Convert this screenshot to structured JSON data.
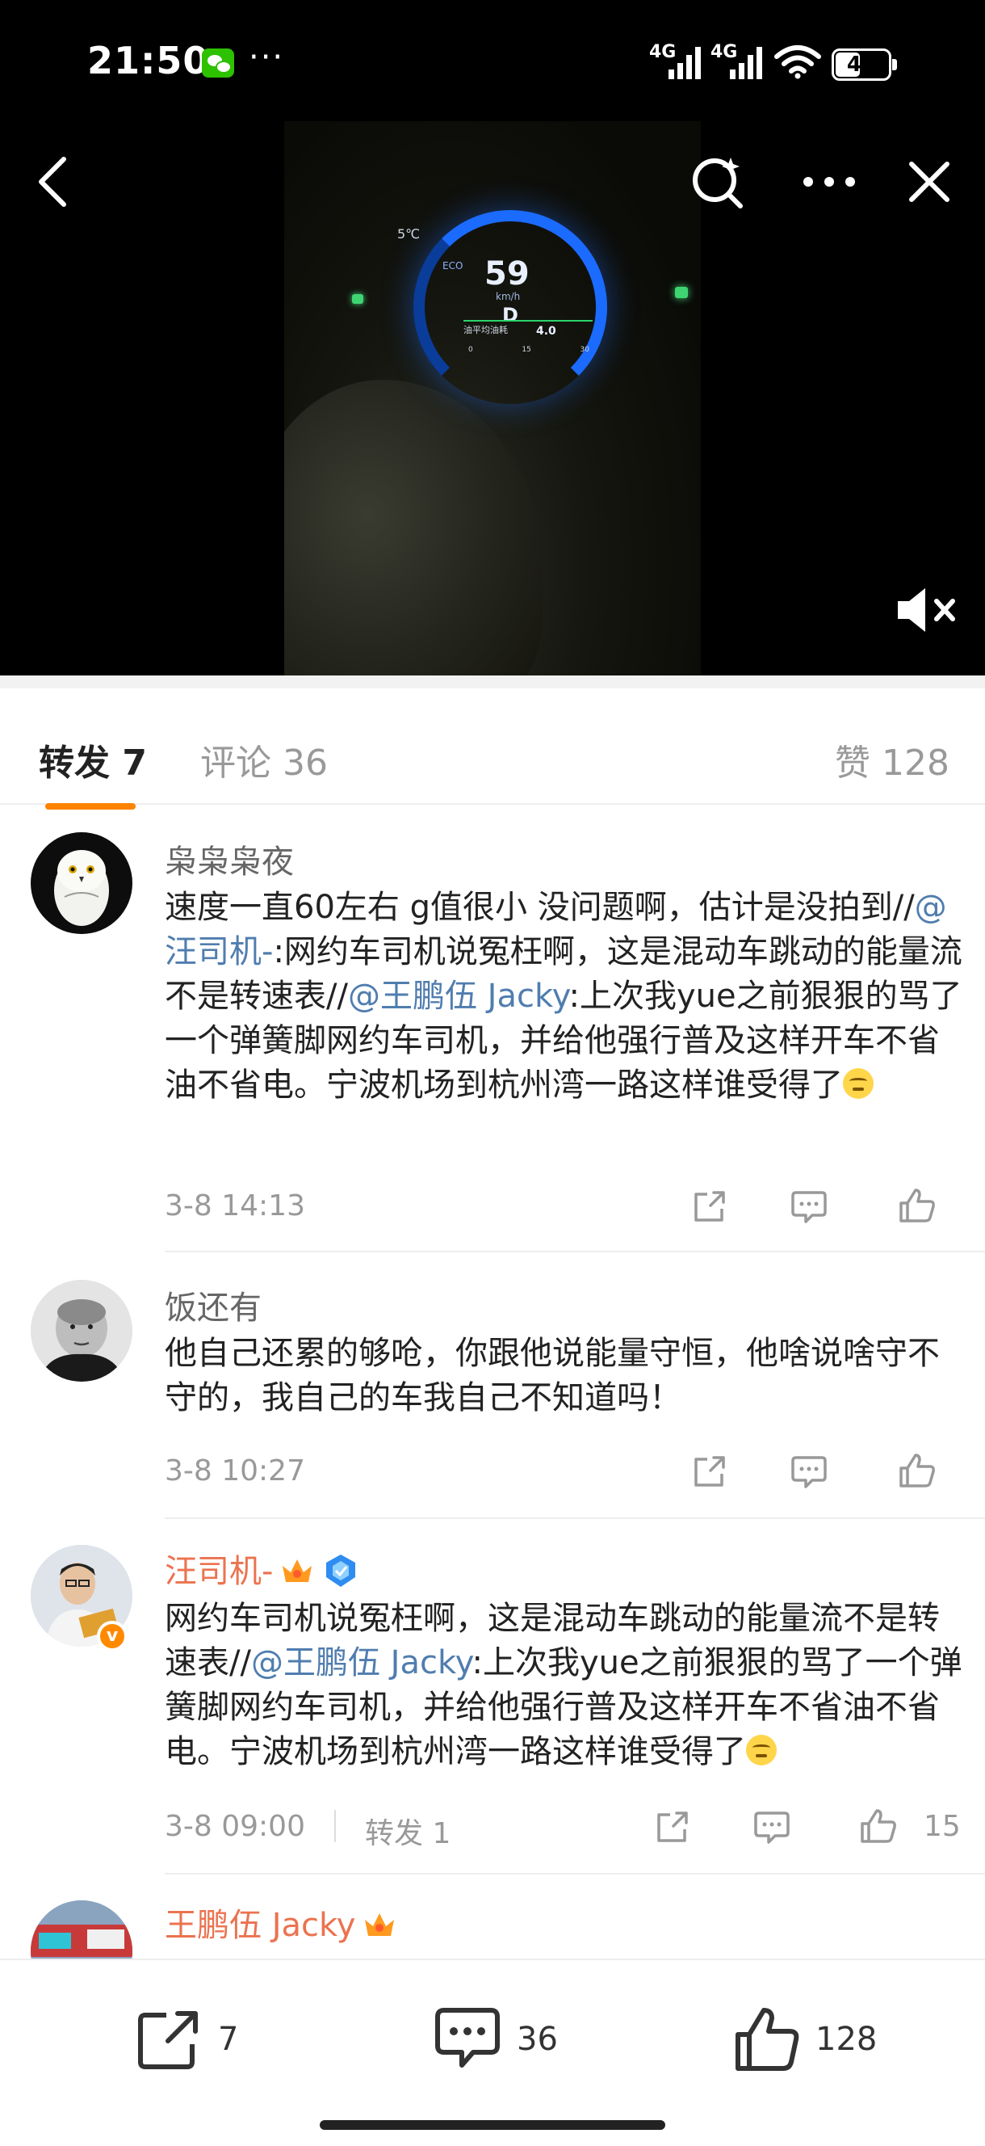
{
  "status_bar": {
    "time": "21:50",
    "more": "···",
    "net1": "4G",
    "net2": "4G",
    "battery": "44"
  },
  "icons": {
    "wechat": "wechat-icon",
    "back": "chevron-left-icon",
    "search": "search-sparkle-icon",
    "more": "more-horizontal-icon",
    "close": "close-icon",
    "mute": "speaker-muted-icon",
    "share": "share-icon",
    "comment": "comment-icon",
    "like": "thumb-up-icon"
  },
  "video": {
    "dash_temp": "5℃",
    "dash_speed": "59",
    "dash_unit": "km/h",
    "dash_gear": "D",
    "dash_eco": "ECO",
    "dash_info": "油平均油耗",
    "dash_fuel": "4.0",
    "dash_scale": [
      "0",
      "15",
      "30"
    ]
  },
  "tabs": {
    "repost": "转发 7",
    "comment": "评论 36",
    "like": "赞 128"
  },
  "reposts": [
    {
      "username": "枭枭枭夜",
      "text_1": "速度一直60左右 g值很小 没问题啊，估计是没拍到//",
      "mention_1": "@汪司机-",
      "text_2": ":网约车司机说冤枉啊，这是混动车跳动的能量流不是转速表//",
      "mention_2": "@王鹏伍 Jacky",
      "text_3": ":上次我yue之前狠狠的骂了一个弹簧脚网约车司机，并给他强行普及这样开车不省油不省电。宁波机场到杭州湾一路这样谁受得了",
      "time": "3-8 14:13"
    },
    {
      "username": "饭还有",
      "text_1": "他自己还累的够呛，你跟他说能量守恒，他啥说啥守不守的，我自己的车我自己不知道吗！",
      "time": "3-8 10:27"
    },
    {
      "username": "汪司机-",
      "text_1": "网约车司机说冤枉啊，这是混动车跳动的能量流不是转速表//",
      "mention_1": "@王鹏伍 Jacky",
      "text_2": ":上次我yue之前狠狠的骂了一个弹簧脚网约车司机，并给他强行普及这样开车不省油不省电。宁波机场到杭州湾一路这样谁受得了",
      "time": "3-8 09:00",
      "repost_count": "转发 1",
      "like_count": "15"
    },
    {
      "username": "王鹏伍 Jacky"
    }
  ],
  "bottom_bar": {
    "share_count": "7",
    "comment_count": "36",
    "like_count": "128"
  },
  "colors": {
    "accent": "#ff8200",
    "mention": "#507daf",
    "username_highlight": "#eb7350"
  }
}
